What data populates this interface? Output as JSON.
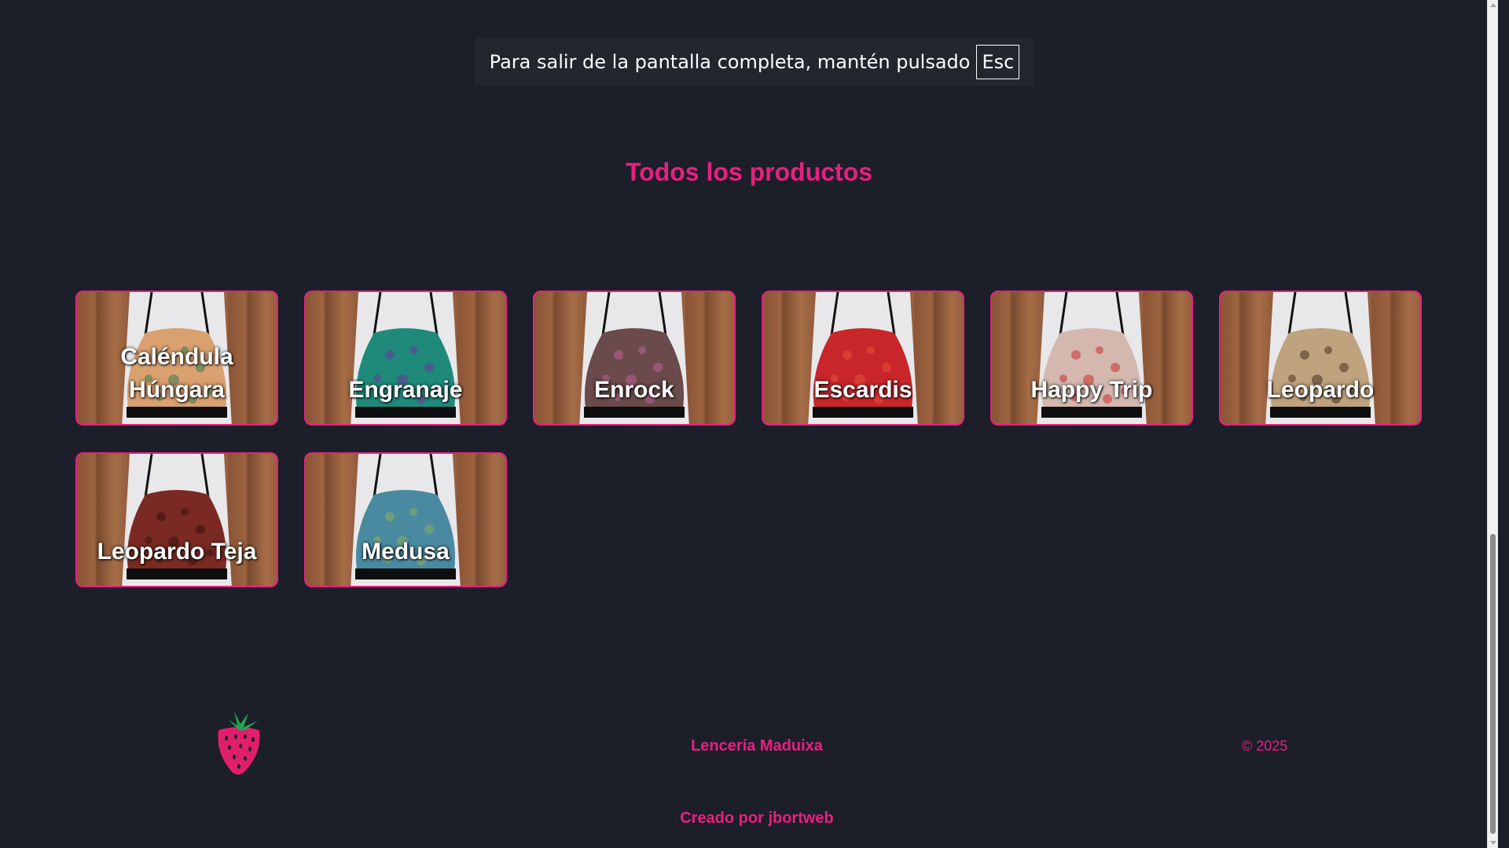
{
  "fullscreen_notice": {
    "text": "Para salir de la pantalla completa, mantén pulsado",
    "key": "Esc"
  },
  "page_title": "Todos los productos",
  "products": [
    {
      "name": "Caléndula\nHúngara",
      "pattern": "#d9a070",
      "accent": "#3a7a4a"
    },
    {
      "name": "Engranaje",
      "pattern": "#1f8a7a",
      "accent": "#6a3aa0"
    },
    {
      "name": "Enrock",
      "pattern": "#6a4a4a",
      "accent": "#c0609a"
    },
    {
      "name": "Escardis",
      "pattern": "#c8262a",
      "accent": "#e8503a"
    },
    {
      "name": "Happy Trip",
      "pattern": "#d4b8b0",
      "accent": "#c8302a"
    },
    {
      "name": "Leopardo",
      "pattern": "#bfa27e",
      "accent": "#4a3220"
    },
    {
      "name": "Leopardo Teja",
      "pattern": "#7a2a22",
      "accent": "#3a1410"
    },
    {
      "name": "Medusa",
      "pattern": "#4a8aa0",
      "accent": "#8ab060"
    }
  ],
  "footer": {
    "brand": "Lencería Maduixa",
    "copyright": "© 2025",
    "credit": "Creado por jbortweb",
    "logo_icon": "strawberry-icon"
  },
  "colors": {
    "background": "#1c1e2a",
    "accent": "#e8207f"
  }
}
